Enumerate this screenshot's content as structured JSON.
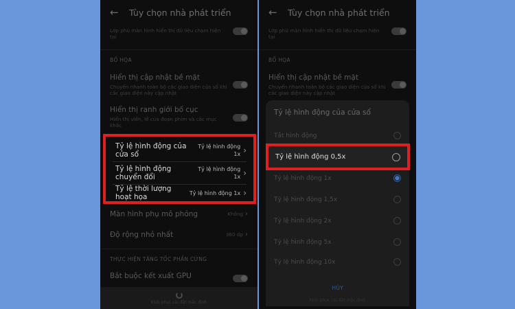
{
  "header": {
    "title": "Tùy chọn nhà phát triển"
  },
  "left": {
    "top_item_sub": "Lớp phủ màn hình hiển thị dữ liệu chạm hiện tại",
    "section_drawing": "BỐ HỌA",
    "show_surface_title": "Hiển thị cập nhật bề mặt",
    "show_surface_sub": "Chuyển nhanh toàn bộ các giao diện cửa sổ khi các giao diện này cập nhật",
    "show_layout_title": "Hiển thị ranh giới bố cục",
    "show_layout_sub": "Hiển thị viền, lề của đoạn phim và các mục khác",
    "highlighted": [
      {
        "title": "Tỷ lệ hình động của cửa sổ",
        "value": "Tỷ lệ hình động 1x"
      },
      {
        "title": "Tỷ lệ hình động chuyển đổi",
        "value": "Tỷ lệ hình động 1x"
      },
      {
        "title": "Tỷ lệ thời lượng hoạt họa",
        "value": "Tỷ lệ hình động 1x"
      }
    ],
    "simulate_display_title": "Màn hình phụ mô phỏng",
    "simulate_display_value": "Không",
    "min_width_title": "Độ rộng nhỏ nhất",
    "min_width_value": "360 dp",
    "section_hw": "THỰC HIỆN TĂNG TỐC PHẦN CỨNG",
    "force_gpu_title": "Bắt buộc kết xuất GPU",
    "bottom_text": "Khôi phục cài đặt mặc định"
  },
  "dialog": {
    "title": "Tỷ lệ hình động của cửa sổ",
    "options": [
      {
        "label": "Tắt hình động",
        "checked": false
      },
      {
        "label": "Tỷ lệ hình động 0,5x",
        "checked": false
      },
      {
        "label": "Tỷ lệ hình động 1x",
        "checked": true
      },
      {
        "label": "Tỷ lệ hình động 1,5x",
        "checked": false
      },
      {
        "label": "Tỷ lệ hình động 2x",
        "checked": false
      },
      {
        "label": "Tỷ lệ hình động 5x",
        "checked": false
      },
      {
        "label": "Tỷ lệ hình động 10x",
        "checked": false
      }
    ],
    "cancel": "HỦY",
    "footer": "Khôi phục cài đặt mặc định"
  },
  "colors": {
    "highlight": "#e02020",
    "background": "#6a97dc",
    "accent": "#3f75c7"
  }
}
